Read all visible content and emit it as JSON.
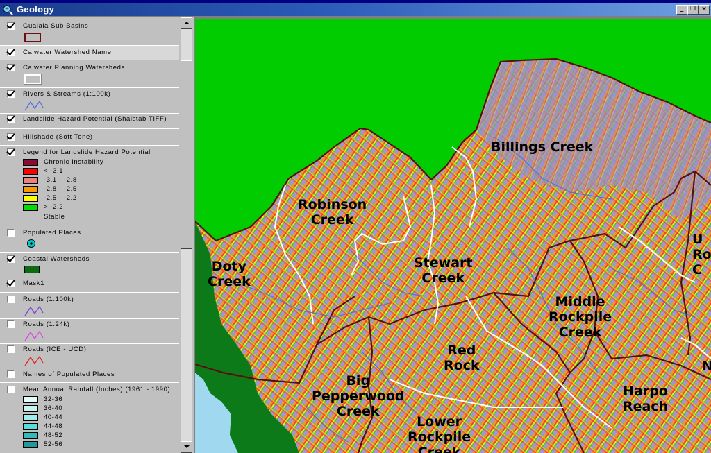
{
  "window": {
    "title": "Geology",
    "app_icon": "globe-magnifier-icon",
    "buttons": {
      "minimize": "_",
      "restore": "❐",
      "close": "×"
    }
  },
  "toc": {
    "layers": [
      {
        "label": "Gualala Sub Basins",
        "checked": true,
        "symbol": "polygon-outline-maroon"
      },
      {
        "label": "Calwater Watershed Name",
        "checked": true,
        "selected": true
      },
      {
        "label": "Calwater Planning Watersheds",
        "checked": true,
        "symbol": "polygon-outline-white"
      },
      {
        "label": "Rivers & Streams (1:100k)",
        "checked": true,
        "symbol": "line-blue"
      },
      {
        "label": "Landslide Hazard Potential (Shalstab TIFF)",
        "checked": true
      },
      {
        "label": "Hillshade (Soft Tone)",
        "checked": true
      },
      {
        "label": "Legend for Landslide Hazard Potential",
        "checked": true
      },
      {
        "label": "Populated Places",
        "checked": false,
        "symbol": "point-cyan"
      },
      {
        "label": "Coastal Watersheds",
        "checked": true,
        "symbol": "polygon-fill-green"
      },
      {
        "label": "Mask1",
        "checked": true
      },
      {
        "label": "Roads (1:100k)",
        "checked": false,
        "symbol": "line-purple"
      },
      {
        "label": "Roads (1:24k)",
        "checked": false,
        "symbol": "line-magenta"
      },
      {
        "label": "Roads (ICE - UCD)",
        "checked": false,
        "symbol": "line-red"
      },
      {
        "label": "Names of Populated Places",
        "checked": false
      },
      {
        "label": "Mean Annual Rainfall (Inches) (1961 - 1990)",
        "checked": false
      }
    ],
    "landslide_legend": [
      {
        "label": "Chronic Instability",
        "color": "#8b0a32"
      },
      {
        "label": "<  -3.1",
        "color": "#ff0000"
      },
      {
        "label": "-3.1 - -2.8",
        "color": "#f08080"
      },
      {
        "label": "-2.8 - -2.5",
        "color": "#ff9900"
      },
      {
        "label": "-2.5 - -2.2",
        "color": "#ffff00"
      },
      {
        "label": ">  -2.2",
        "color": "#00dd00"
      },
      {
        "label": "Stable",
        "color": ""
      }
    ],
    "rainfall_legend": [
      {
        "label": "32-36",
        "color": "#e6fbfb"
      },
      {
        "label": "36-40",
        "color": "#c8f3f3"
      },
      {
        "label": "40-44",
        "color": "#a0ecec"
      },
      {
        "label": "44-48",
        "color": "#55dede"
      },
      {
        "label": "48-52",
        "color": "#33bbbb"
      },
      {
        "label": "52-56",
        "color": "#229999"
      }
    ]
  },
  "map": {
    "labels": [
      "Billings Creek",
      "Robinson\nCreek",
      "Doty\nCreek",
      "Stewart\nCreek",
      "Middle\nRockpile\nCreek",
      "Red\nRock",
      "Big\nPepperwood\nCreek",
      "Lower\nRockpile\nCreek",
      "Harpo\nReach",
      "U\nRo\nC",
      "N"
    ],
    "colors": {
      "mask": "#00cc00",
      "ocean": "#9fd8ef",
      "coastal": "#0d7a1a",
      "terrain": "#9b8fcf",
      "basin_outline": "#5a0f0f",
      "watershed_outline": "#ffffff",
      "river": "#4a6fd8"
    }
  }
}
